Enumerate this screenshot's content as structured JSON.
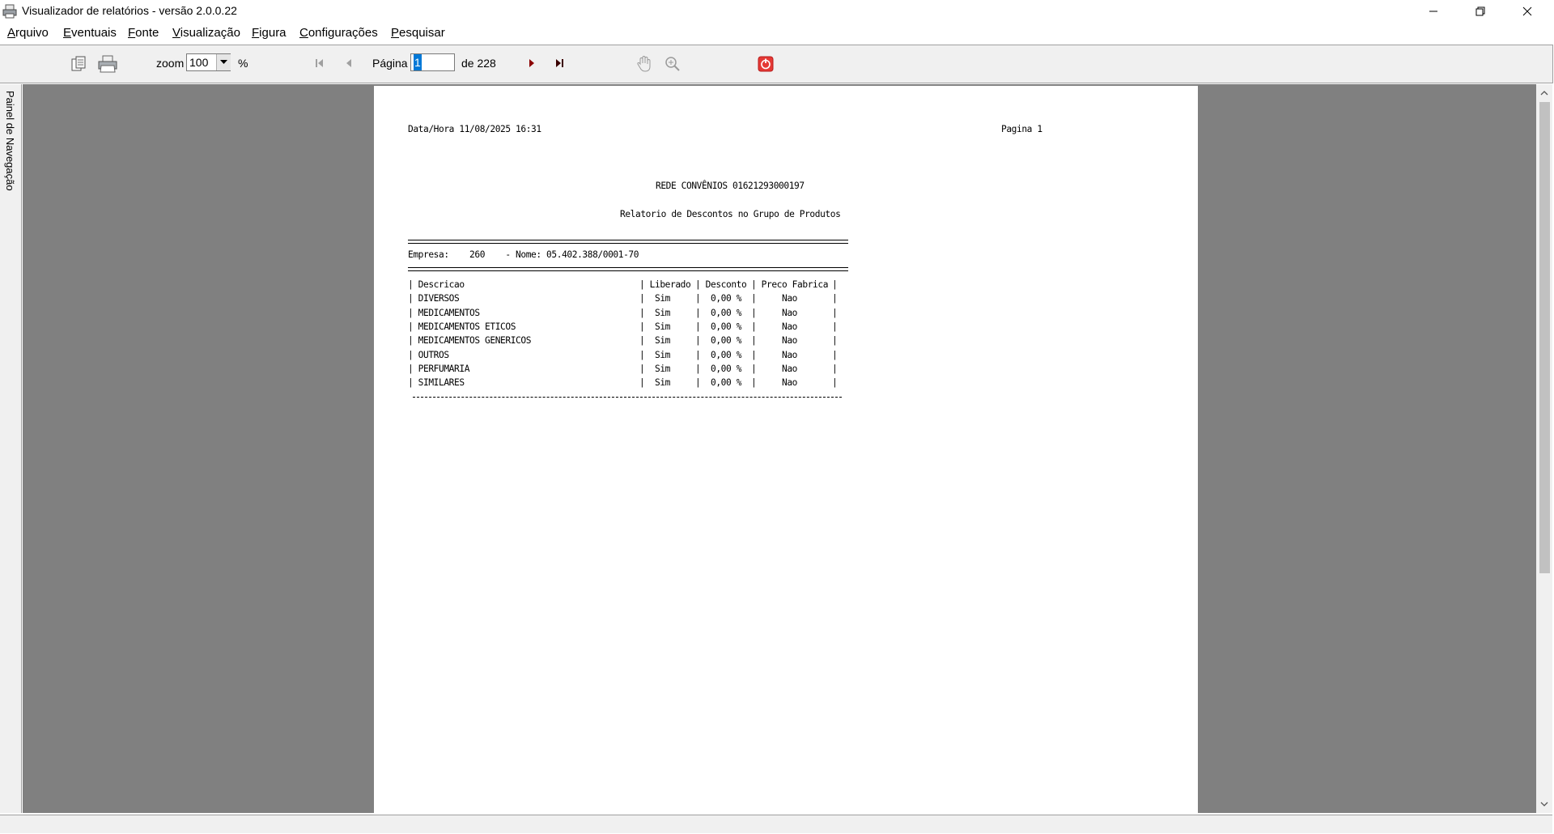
{
  "window": {
    "title": "Visualizador de relatórios - versão 2.0.0.22",
    "minimize_icon": "minimize-icon",
    "maximize_icon": "restore-icon",
    "close_icon": "close-icon"
  },
  "menu": {
    "items": [
      {
        "accel": "A",
        "rest": "rquivo"
      },
      {
        "accel": "E",
        "rest": "ventuais"
      },
      {
        "accel": "F",
        "rest": "onte"
      },
      {
        "accel": "V",
        "rest": "isualização"
      },
      {
        "accel": "F",
        "rest": "igura"
      },
      {
        "accel": "C",
        "rest": "onfigurações"
      },
      {
        "accel": "P",
        "rest": "esquisar"
      }
    ]
  },
  "toolbar": {
    "zoom_label": "zoom",
    "zoom_value": "100",
    "zoom_unit": "%",
    "page_label": "Página",
    "page_value": "1",
    "page_total": "de 228",
    "colors": {
      "nav_arrow": "#8b0000",
      "stop": "#e53935"
    }
  },
  "nav_panel": {
    "label": "Painel de Navegação"
  },
  "report": {
    "datetime": "Data/Hora 11/08/2025 16:31",
    "page": "Pagina 1",
    "company_title": "REDE CONVÊNIOS 01621293000197",
    "report_title": "Relatorio de Descontos no Grupo de Produtos",
    "empresa_line": "Empresa:    260    - Nome: 05.402.388/0001-70",
    "headers": [
      "| Descricao",
      "| Liberado",
      "| Desconto",
      "| Preco Fabrica",
      "|"
    ],
    "rows": [
      {
        "descricao": "DIVERSOS",
        "liberado": "Sim",
        "desconto": "0,00 %",
        "preco_fabrica": "Nao"
      },
      {
        "descricao": "MEDICAMENTOS",
        "liberado": "Sim",
        "desconto": "0,00 %",
        "preco_fabrica": "Nao"
      },
      {
        "descricao": "MEDICAMENTOS ETICOS",
        "liberado": "Sim",
        "desconto": "0,00 %",
        "preco_fabrica": "Nao"
      },
      {
        "descricao": "MEDICAMENTOS GENERICOS",
        "liberado": "Sim",
        "desconto": "0,00 %",
        "preco_fabrica": "Nao"
      },
      {
        "descricao": "OUTROS",
        "liberado": "Sim",
        "desconto": "0,00 %",
        "preco_fabrica": "Nao"
      },
      {
        "descricao": "PERFUMARIA",
        "liberado": "Sim",
        "desconto": "0,00 %",
        "preco_fabrica": "Nao"
      },
      {
        "descricao": "SIMILARES",
        "liberado": "Sim",
        "desconto": "0,00 %",
        "preco_fabrica": "Nao"
      }
    ]
  }
}
